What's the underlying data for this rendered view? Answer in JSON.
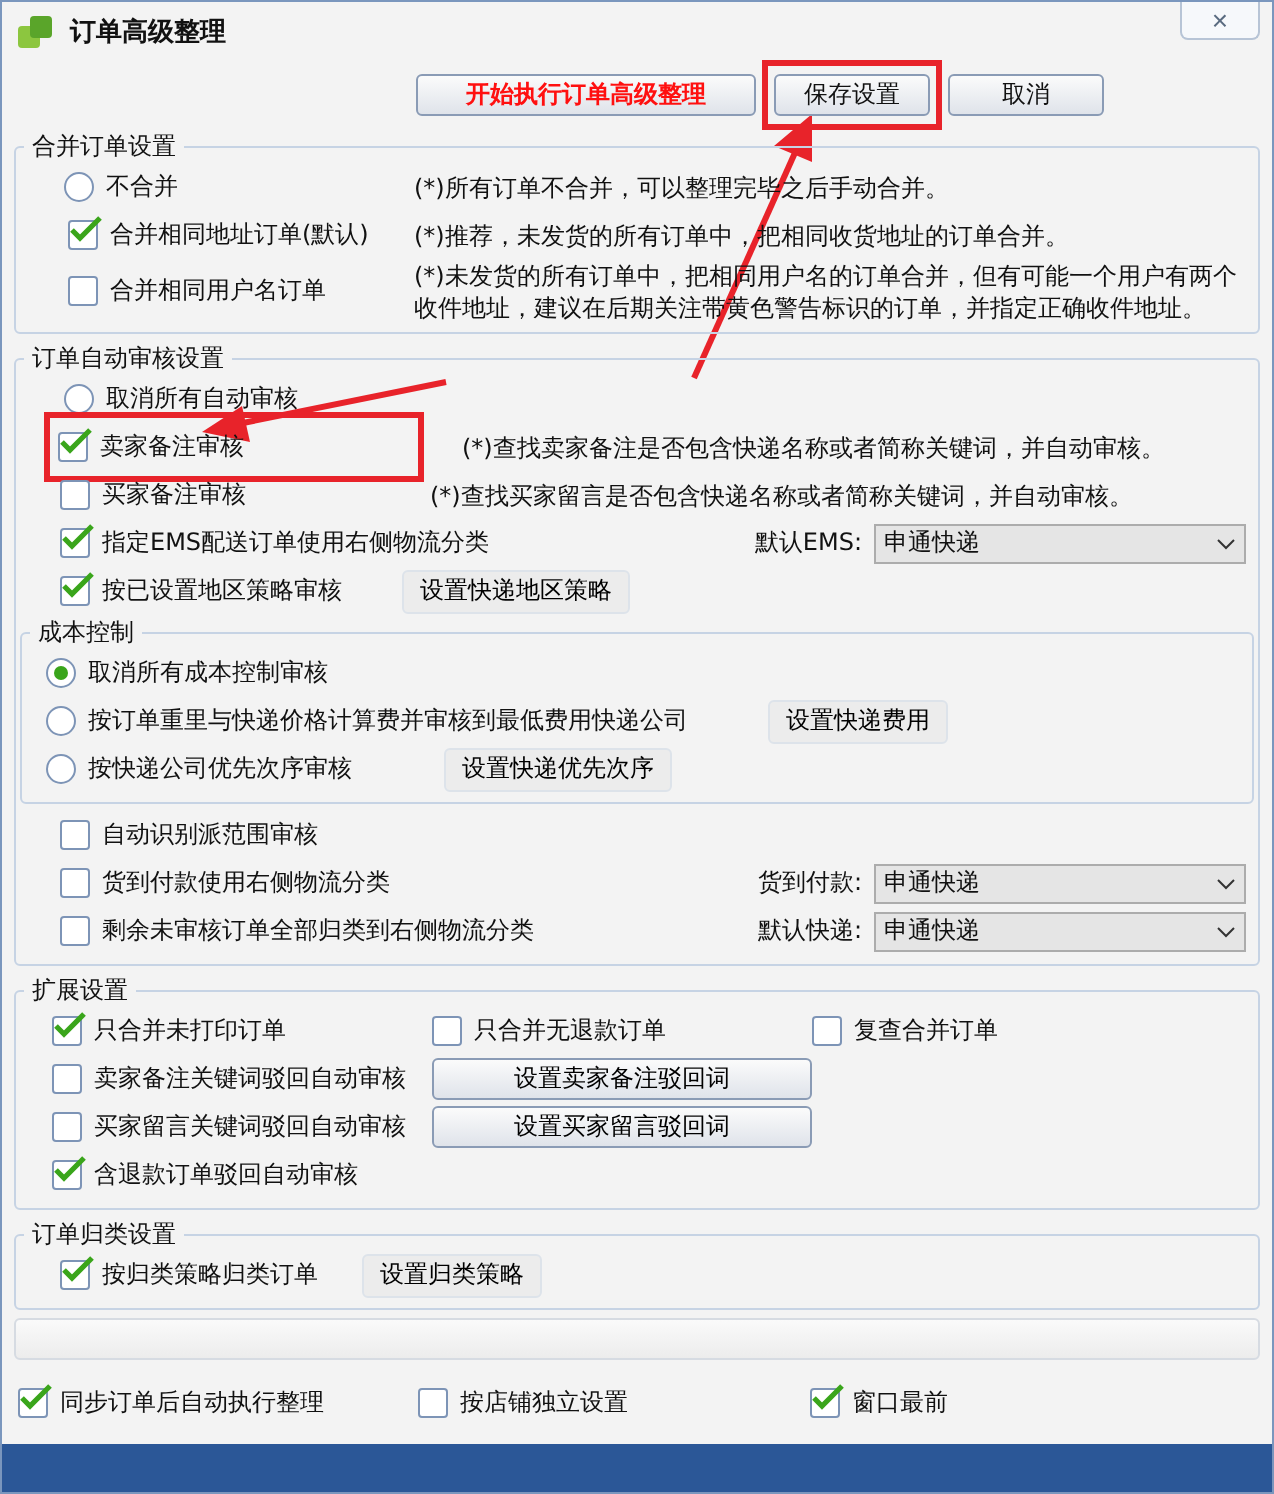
{
  "window": {
    "title": "订单高级整理",
    "close_label": "×"
  },
  "toolbar": [
    {
      "label": "开始执行订单高级整理",
      "kind": "primary",
      "highlighted": false
    },
    {
      "label": "保存设置",
      "kind": "normal",
      "highlighted": true
    },
    {
      "label": "取消",
      "kind": "normal",
      "highlighted": false
    }
  ],
  "merge": {
    "title": "合并订单设置",
    "options": [
      {
        "kind": "radio",
        "label": "不合并",
        "selected": false,
        "note": "(*)所有订单不合并，可以整理完毕之后手动合并。"
      },
      {
        "kind": "checkbox",
        "label": "合并相同地址订单(默认)",
        "checked": true,
        "note": "(*)推荐，未发货的所有订单中，把相同收货地址的订单合并。"
      },
      {
        "kind": "checkbox",
        "label": "合并相同用户名订单",
        "checked": false,
        "note": "(*)未发货的所有订单中，把相同用户名的订单合并，但有可能一个用户有两个收件地址，建议在后期关注带黄色警告标识的订单，并指定正确收件地址。"
      }
    ]
  },
  "audit": {
    "title": "订单自动审核设置",
    "options": [
      {
        "kind": "radio",
        "label": "取消所有自动审核",
        "selected": false
      },
      {
        "kind": "checkbox",
        "label": "卖家备注审核",
        "checked": true,
        "highlighted": true,
        "note": "(*)查找卖家备注是否包含快递名称或者简称关键词，并自动审核。"
      },
      {
        "kind": "checkbox",
        "label": "买家备注审核",
        "checked": false,
        "highlighted": false,
        "note": "(*)查找买家留言是否包含快递名称或者简称关键词，并自动审核。"
      },
      {
        "kind": "checkbox",
        "label": "指定EMS配送订单使用右侧物流分类",
        "checked": true,
        "highlighted": false,
        "select_label": "默认EMS:",
        "select_value": "申通快递"
      },
      {
        "kind": "checkbox",
        "label": "按已设置地区策略审核",
        "checked": true,
        "highlighted": false,
        "button": "设置快递地区策略"
      }
    ],
    "cost": {
      "title": "成本控制",
      "options": [
        {
          "label": "取消所有成本控制审核",
          "selected": true
        },
        {
          "label": "按订单重里与快递价格计算费并审核到最低费用快递公司",
          "selected": false,
          "button": "设置快递费用"
        },
        {
          "label": "按快递公司优先次序审核",
          "selected": false,
          "button": "设置快递优先次序"
        }
      ]
    },
    "more": [
      {
        "label": "自动识别派范围审核",
        "checked": false
      },
      {
        "label": "货到付款使用右侧物流分类",
        "checked": false,
        "select_label": "货到付款:",
        "select_value": "申通快递"
      },
      {
        "label": "剩余未审核订单全部归类到右侧物流分类",
        "checked": false,
        "select_label": "默认快递:",
        "select_value": "申通快递"
      }
    ]
  },
  "extension": {
    "title": "扩展设置",
    "rows": [
      [
        {
          "kind": "checkbox",
          "label": "只合并未打印订单",
          "checked": true
        },
        {
          "kind": "checkbox",
          "label": "只合并无退款订单",
          "checked": false
        },
        {
          "kind": "checkbox",
          "label": "复查合并订单",
          "checked": false
        }
      ],
      [
        {
          "kind": "checkbox",
          "label": "卖家备注关键词驳回自动审核",
          "checked": false
        },
        {
          "kind": "button",
          "label": "设置卖家备注驳回词"
        }
      ],
      [
        {
          "kind": "checkbox",
          "label": "买家留言关键词驳回自动审核",
          "checked": false
        },
        {
          "kind": "button",
          "label": "设置买家留言驳回词"
        }
      ],
      [
        {
          "kind": "checkbox",
          "label": "含退款订单驳回自动审核",
          "checked": true
        }
      ]
    ]
  },
  "classify": {
    "title": "订单归类设置",
    "label": "按归类策略归类订单",
    "checked": true,
    "button": "设置归类策略"
  },
  "footer": [
    {
      "label": "同步订单后自动执行整理",
      "checked": true
    },
    {
      "label": "按店铺独立设置",
      "checked": false
    },
    {
      "label": "窗口最前",
      "checked": true
    }
  ]
}
